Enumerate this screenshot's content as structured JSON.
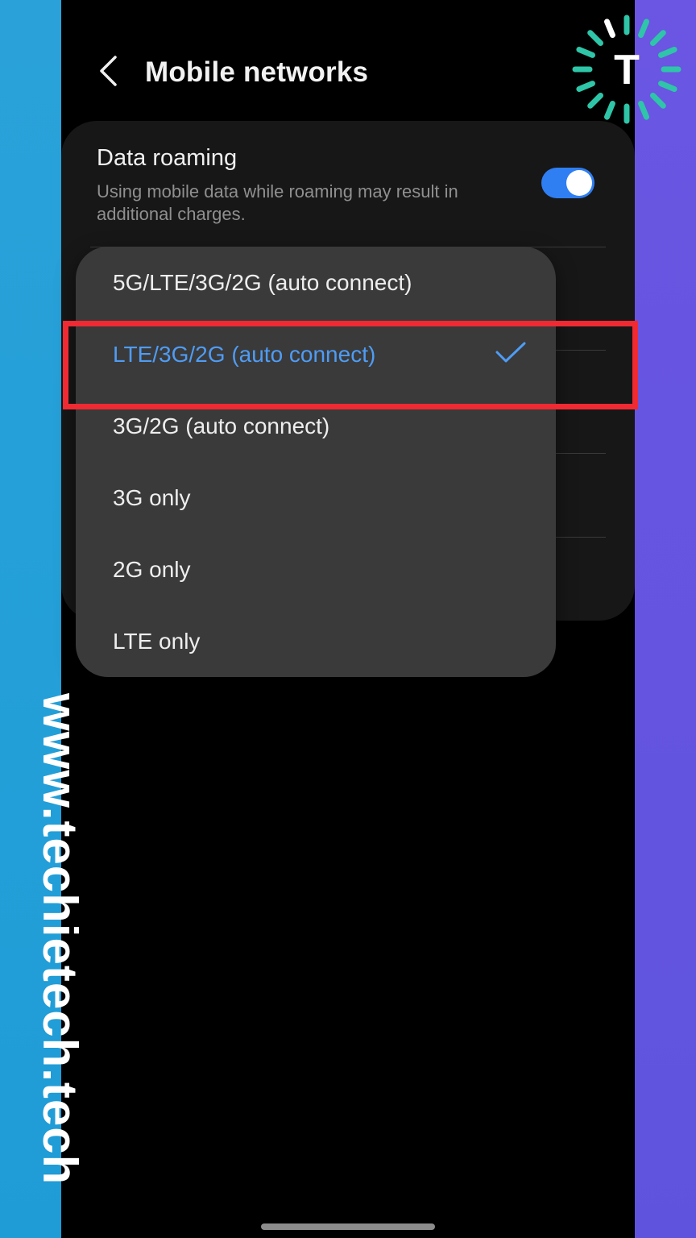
{
  "header": {
    "title": "Mobile networks",
    "back_icon": "chevron-left-icon"
  },
  "data_roaming": {
    "title": "Data roaming",
    "description": "Using mobile data while roaming may result in additional charges.",
    "enabled": true
  },
  "network_mode_dropdown": {
    "options": [
      {
        "label": "5G/LTE/3G/2G (auto connect)",
        "selected": false
      },
      {
        "label": "LTE/3G/2G (auto connect)",
        "selected": true
      },
      {
        "label": "3G/2G (auto connect)",
        "selected": false
      },
      {
        "label": "3G only",
        "selected": false
      },
      {
        "label": "2G only",
        "selected": false
      },
      {
        "label": "LTE only",
        "selected": false
      }
    ]
  },
  "watermark": {
    "text": "www.techietech.tech",
    "logo_letter": "T"
  },
  "colors": {
    "accent": "#4f9cf5",
    "toggle_on": "#2f7ef2",
    "highlight": "#ef2a32",
    "logo_teal": "#2ec5a8"
  }
}
